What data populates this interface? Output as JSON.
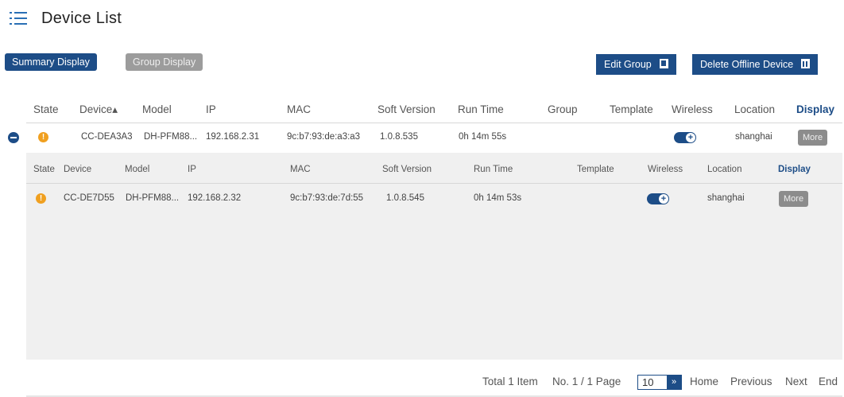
{
  "header": {
    "title": "Device List"
  },
  "toolbar": {
    "summary_display": "Summary Display",
    "group_display": "Group Display",
    "edit_group": "Edit Group",
    "delete_offline": "Delete Offline Device"
  },
  "table": {
    "columns": {
      "state": "State",
      "device": "Device▴",
      "model": "Model",
      "ip": "IP",
      "mac": "MAC",
      "soft_version": "Soft Version",
      "run_time": "Run Time",
      "group": "Group",
      "template": "Template",
      "wireless": "Wireless",
      "location": "Location",
      "display": "Display"
    },
    "rows": [
      {
        "device": "CC-DEA3A3",
        "model": "DH-PFM88...",
        "ip": "192.168.2.31",
        "mac": "9c:b7:93:de:a3:a3",
        "soft_version": "1.0.8.535",
        "run_time": "0h 14m 55s",
        "group": "",
        "template": "",
        "wireless": "on",
        "location": "shanghai",
        "action": "More"
      }
    ]
  },
  "subtable": {
    "columns": {
      "state": "State",
      "device": "Device",
      "model": "Model",
      "ip": "IP",
      "mac": "MAC",
      "soft_version": "Soft Version",
      "run_time": "Run Time",
      "template": "Template",
      "wireless": "Wireless",
      "location": "Location",
      "display": "Display"
    },
    "rows": [
      {
        "device": "CC-DE7D55",
        "model": "DH-PFM88...",
        "ip": "192.168.2.32",
        "mac": "9c:b7:93:de:7d:55",
        "soft_version": "1.0.8.545",
        "run_time": "0h 14m 53s",
        "template": "",
        "wireless": "on",
        "location": "shanghai",
        "action": "More"
      }
    ]
  },
  "pagination": {
    "total": "Total 1 Item",
    "page_info": "No. 1 / 1 Page",
    "page_size": "10",
    "home": "Home",
    "previous": "Previous",
    "next": "Next",
    "end": "End"
  },
  "colors": {
    "primary": "#1d4d87",
    "warning": "#f0a020",
    "muted": "#9c9c9c"
  }
}
